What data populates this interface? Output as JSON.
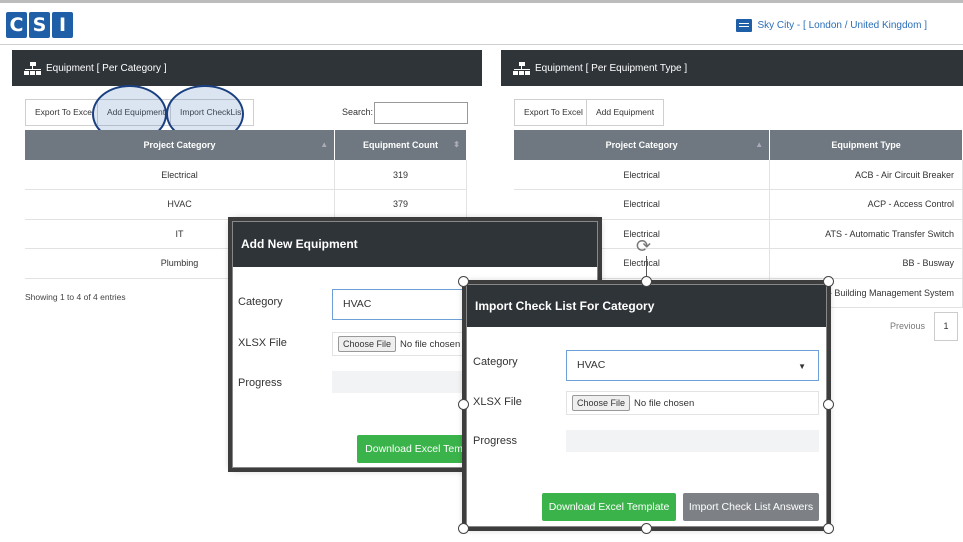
{
  "header": {
    "logo_letters": [
      "C",
      "S",
      "I"
    ],
    "site": "Sky City - [ London / United Kingdom ]"
  },
  "left_panel": {
    "title": "Equipment [ Per Category ]",
    "buttons": [
      "Export To Excel",
      "Add Equipment",
      "Import CheckList"
    ],
    "search_label": "Search:",
    "columns": [
      "Project Category",
      "Equipment Count"
    ],
    "rows": [
      [
        "Electrical",
        "319"
      ],
      [
        "HVAC",
        "379"
      ],
      [
        "IT",
        ""
      ],
      [
        "Plumbing",
        ""
      ]
    ],
    "entries": "Showing 1 to 4 of 4 entries"
  },
  "right_panel": {
    "title": "Equipment [ Per Equipment Type ]",
    "buttons": [
      "Export To Excel",
      "Add Equipment"
    ],
    "columns": [
      "Project Category",
      "Equipment Type"
    ],
    "rows": [
      [
        "Electrical",
        "ACB - Air Circuit Breaker"
      ],
      [
        "Electrical",
        "ACP - Access Control"
      ],
      [
        "Electrical",
        "ATS - Automatic Transfer Switch"
      ],
      [
        "Electrical",
        "BB - Busway"
      ],
      [
        "",
        "BMS - Building Management System"
      ]
    ],
    "pager_previous": "Previous",
    "pager_page": "1"
  },
  "add_modal": {
    "title": "Add New Equipment",
    "category_label": "Category",
    "category_value": "HVAC",
    "file_label": "XLSX File",
    "choose_label": "Choose File",
    "no_file": "No file chosen",
    "progress_label": "Progress",
    "download_button": "Download Excel Temp"
  },
  "import_modal": {
    "title": "Import Check List For Category",
    "category_label": "Category",
    "category_value": "HVAC",
    "file_label": "XLSX File",
    "choose_label": "Choose File",
    "no_file": "No file chosen",
    "progress_label": "Progress",
    "download_button": "Download Excel Template",
    "import_button": "Import Check List Answers"
  },
  "colors": {
    "dark_header": "#2f3439",
    "table_header": "#6f7880",
    "green_button": "#3ab44a",
    "grey_button": "#7d8185",
    "brand_blue": "#1f5fa8"
  }
}
